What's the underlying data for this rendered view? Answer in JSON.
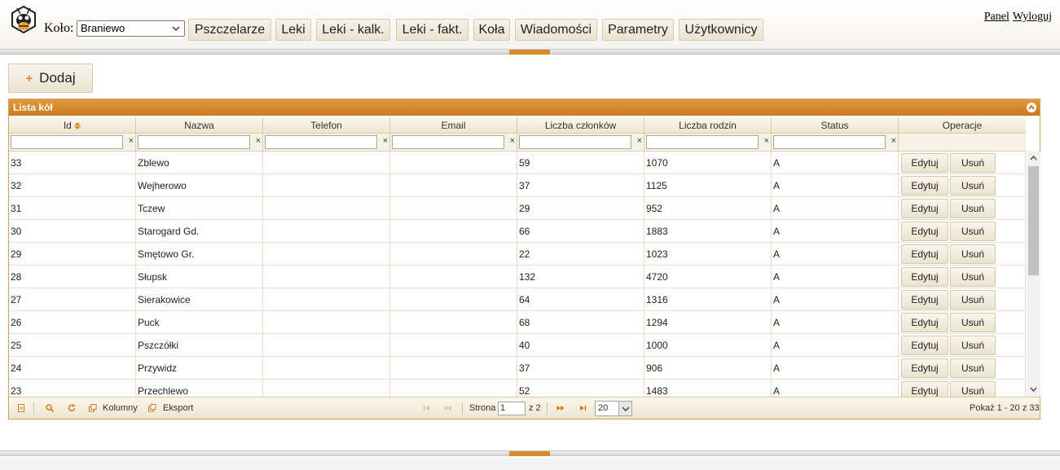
{
  "header": {
    "kolo_label": "Koło:",
    "kolo_selected": "Braniewo",
    "nav": [
      "Pszczelarze",
      "Leki",
      "Leki - kalk.",
      "Leki - fakt.",
      "Koła",
      "Wiadomości",
      "Parametry",
      "Użytkownicy"
    ],
    "panel_link": "Panel",
    "logout_link": "Wyloguj"
  },
  "toolbar": {
    "add_label": "Dodaj"
  },
  "grid": {
    "title": "Lista kół",
    "columns": [
      "Id",
      "Nazwa",
      "Telefon",
      "Email",
      "Liczba członków",
      "Liczba rodzin",
      "Status",
      "Operacje"
    ],
    "rows": [
      {
        "id": "33",
        "nazwa": "Zblewo",
        "telefon": "",
        "email": "",
        "czlonkow": "59",
        "rodzin": "1070",
        "status": "A"
      },
      {
        "id": "32",
        "nazwa": "Wejherowo",
        "telefon": "",
        "email": "",
        "czlonkow": "37",
        "rodzin": "1125",
        "status": "A"
      },
      {
        "id": "31",
        "nazwa": "Tczew",
        "telefon": "",
        "email": "",
        "czlonkow": "29",
        "rodzin": "952",
        "status": "A"
      },
      {
        "id": "30",
        "nazwa": "Starogard Gd.",
        "telefon": "",
        "email": "",
        "czlonkow": "66",
        "rodzin": "1883",
        "status": "A"
      },
      {
        "id": "29",
        "nazwa": "Smętowo Gr.",
        "telefon": "",
        "email": "",
        "czlonkow": "22",
        "rodzin": "1023",
        "status": "A"
      },
      {
        "id": "28",
        "nazwa": "Słupsk",
        "telefon": "",
        "email": "",
        "czlonkow": "132",
        "rodzin": "4720",
        "status": "A"
      },
      {
        "id": "27",
        "nazwa": "Sierakowice",
        "telefon": "",
        "email": "",
        "czlonkow": "64",
        "rodzin": "1316",
        "status": "A"
      },
      {
        "id": "26",
        "nazwa": "Puck",
        "telefon": "",
        "email": "",
        "czlonkow": "68",
        "rodzin": "1294",
        "status": "A"
      },
      {
        "id": "25",
        "nazwa": "Pszczółki",
        "telefon": "",
        "email": "",
        "czlonkow": "40",
        "rodzin": "1000",
        "status": "A"
      },
      {
        "id": "24",
        "nazwa": "Przywidz",
        "telefon": "",
        "email": "",
        "czlonkow": "37",
        "rodzin": "906",
        "status": "A"
      },
      {
        "id": "23",
        "nazwa": "Przechlewo",
        "telefon": "",
        "email": "",
        "czlonkow": "52",
        "rodzin": "1483",
        "status": "A"
      }
    ],
    "edit_label": "Edytuj",
    "delete_label": "Usuń"
  },
  "pager": {
    "kolumny": "Kolumny",
    "eksport": "Eksport",
    "strona": "Strona",
    "page_value": "1",
    "of_pages": "z 2",
    "rows_per_page": "20",
    "summary": "Pokaż 1 - 20 z 33"
  },
  "colors": {
    "accent": "#d98b2b",
    "grid_title": "#c97a1f"
  },
  "icons": [
    "bee-logo-icon",
    "chevron-down-icon",
    "plus-icon",
    "collapse-icon",
    "sort-icon",
    "clear-icon",
    "add-record-icon",
    "search-icon",
    "refresh-icon",
    "columns-icon",
    "export-icon",
    "first-page-icon",
    "prev-page-icon",
    "next-page-icon",
    "last-page-icon"
  ]
}
